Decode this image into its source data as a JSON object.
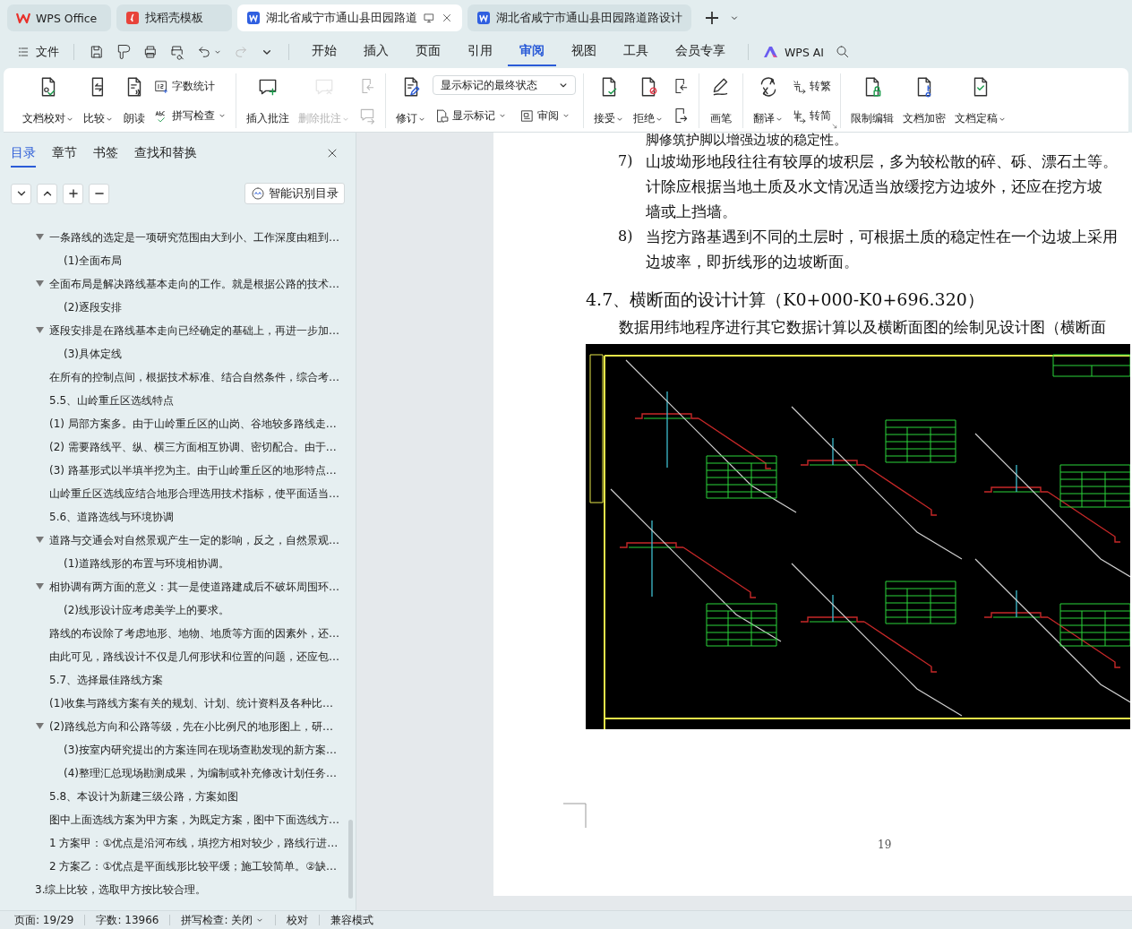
{
  "tabs": [
    {
      "label": "WPS Office",
      "kind": "home",
      "selected": false
    },
    {
      "label": "找稻壳模板",
      "kind": "template",
      "selected": false
    },
    {
      "label": "湖北省咸宁市通山县田园路道",
      "kind": "doc",
      "selected": true
    },
    {
      "label": "湖北省咸宁市通山县田园路道路设计",
      "kind": "doc",
      "selected": false
    }
  ],
  "file_menu": "文件",
  "menu_tabs": [
    {
      "label": "开始",
      "selected": false
    },
    {
      "label": "插入",
      "selected": false
    },
    {
      "label": "页面",
      "selected": false
    },
    {
      "label": "引用",
      "selected": false
    },
    {
      "label": "审阅",
      "selected": true
    },
    {
      "label": "视图",
      "selected": false
    },
    {
      "label": "工具",
      "selected": false
    },
    {
      "label": "会员专享",
      "selected": false
    }
  ],
  "ai_label": "WPS AI",
  "ribbon": {
    "groups": [
      {
        "items": [
          {
            "kind": "large",
            "label": "文档校对",
            "caret": true,
            "disabled": false
          },
          {
            "kind": "large",
            "label": "比较",
            "caret": true,
            "disabled": false
          },
          {
            "kind": "large",
            "label": "朗读",
            "disabled": false
          },
          {
            "kind": "stack",
            "items": [
              {
                "kind": "small",
                "label": "字数统计",
                "disabled": false
              },
              {
                "kind": "small",
                "label": "拼写检查",
                "caret": true,
                "disabled": false
              }
            ]
          }
        ]
      },
      {
        "items": [
          {
            "kind": "large",
            "label": "插入批注",
            "disabled": false
          },
          {
            "kind": "large",
            "label": "删除批注",
            "caret": true,
            "disabled": true
          },
          {
            "kind": "stack",
            "items": [
              {
                "kind": "icon",
                "disabled": true
              },
              {
                "kind": "icon",
                "disabled": true
              }
            ]
          }
        ]
      },
      {
        "items": [
          {
            "kind": "large",
            "label": "修订",
            "caret": true,
            "disabled": false
          },
          {
            "kind": "stack",
            "items": [
              {
                "kind": "select",
                "value": "显示标记的最终状态"
              },
              {
                "kind": "pair",
                "items": [
                  {
                    "kind": "small",
                    "label": "显示标记",
                    "caret": true,
                    "disabled": false
                  },
                  {
                    "kind": "small",
                    "label": "审阅",
                    "caret": true,
                    "disabled": false
                  }
                ]
              }
            ]
          }
        ]
      },
      {
        "items": [
          {
            "kind": "large",
            "label": "接受",
            "caret": true,
            "disabled": false
          },
          {
            "kind": "large",
            "label": "拒绝",
            "caret": true,
            "disabled": false
          },
          {
            "kind": "stack",
            "items": [
              {
                "kind": "icon",
                "disabled": false
              },
              {
                "kind": "icon",
                "disabled": false
              }
            ]
          }
        ]
      },
      {
        "items": [
          {
            "kind": "large",
            "label": "画笔",
            "disabled": false
          }
        ]
      },
      {
        "launcher": true,
        "items": [
          {
            "kind": "large",
            "label": "翻译",
            "caret": true,
            "disabled": false
          },
          {
            "kind": "stack",
            "items": [
              {
                "kind": "small",
                "label": "转繁",
                "disabled": false
              },
              {
                "kind": "small",
                "label": "转简",
                "disabled": false
              }
            ]
          }
        ]
      },
      {
        "items": [
          {
            "kind": "large",
            "label": "限制编辑",
            "disabled": false
          },
          {
            "kind": "large",
            "label": "文档加密",
            "disabled": false
          },
          {
            "kind": "large",
            "label": "文档定稿",
            "caret": true,
            "disabled": false
          }
        ]
      }
    ]
  },
  "nav": {
    "tabs": [
      {
        "label": "目录",
        "selected": true
      },
      {
        "label": "章节",
        "selected": false
      },
      {
        "label": "书签",
        "selected": false
      },
      {
        "label": "查找和替换",
        "selected": false
      }
    ],
    "smart_button": "智能识别目录",
    "items": [
      {
        "label": "一条路线的选定是一项研究范围由大到小、工作深度由粗到…",
        "expanded": true,
        "children": [
          {
            "label": "(1)全面布局"
          }
        ]
      },
      {
        "label": "全面布局是解决路线基本走向的工作。就是根据公路的技术…",
        "expanded": true,
        "children": [
          {
            "label": "(2)逐段安排"
          }
        ]
      },
      {
        "label": "逐段安排是在路线基本走向已经确定的基础上，再进一步加…",
        "expanded": true,
        "children": [
          {
            "label": "(3)具体定线"
          }
        ]
      },
      {
        "label": "在所有的控制点间，根据技术标准、结合自然条件，综合考…"
      },
      {
        "label": "5.5、山岭重丘区选线特点"
      },
      {
        "label": "(1) 局部方案多。由于山岭重丘区的山岗、谷地较多路线走…"
      },
      {
        "label": "(2) 需要路线平、纵、横三方面相互协调、密切配合。由于…"
      },
      {
        "label": "(3) 路基形式以半填半挖为主。由于山岭重丘区的地形特点…"
      },
      {
        "label": "山岭重丘区选线应结合地形合理选用技术指标，使平面适当…"
      },
      {
        "label": "5.6、道路选线与环境协调"
      },
      {
        "label": "道路与交通会对自然景观产生一定的影响，反之，自然景观…",
        "expanded": true,
        "children": [
          {
            "label": "(1)道路线形的布置与环境相协调。"
          }
        ]
      },
      {
        "label": "相协调有两方面的意义：其一是使道路建成后不破坏周围环…",
        "expanded": true,
        "children": [
          {
            "label": "(2)线形设计应考虑美学上的要求。"
          }
        ]
      },
      {
        "label": "路线的布设除了考虑地形、地物、地质等方面的因素外，还…"
      },
      {
        "label": "由此可见，路线设计不仅是几何形状和位置的问题，还应包…"
      },
      {
        "label": "5.7、选择最佳路线方案"
      },
      {
        "label": "(1)收集与路线方案有关的规划、计划、统计资料及各种比…"
      },
      {
        "label": "(2)路线总方向和公路等级，先在小比例尺的地形图上，研…",
        "expanded": true,
        "children": [
          {
            "label": "(3)按室内研究提出的方案连同在现场查勘发现的新方案…"
          },
          {
            "label": "(4)整理汇总现场勘测成果，为编制或补充修改计划任务…"
          }
        ]
      },
      {
        "label": "5.8、本设计为新建三级公路，方案如图"
      },
      {
        "label": "图中上面选线方案为甲方案，为既定方案，图中下面选线方…"
      },
      {
        "label": "1 方案甲：①优点是沿河布线，填挖方相对较少，路线行进…"
      },
      {
        "label": "2 方案乙：①优点是平面线形比较平缓；施工较简单。②缺…"
      }
    ],
    "outer_items": [
      {
        "label": "3.综上比较，选取甲方按比较合理。"
      }
    ]
  },
  "document": {
    "top_line": "脚修筑护脚以增强边坡的稳定性。",
    "list": [
      {
        "marker": "7)",
        "lines": [
          "山坡坳形地段往往有较厚的坡积层，多为较松散的碎、砾、漂石土等。",
          "计除应根据当地土质及水文情况适当放缓挖方边坡外，还应在挖方坡",
          "墙或上挡墙。"
        ]
      },
      {
        "marker": "8)",
        "lines": [
          "当挖方路基遇到不同的土层时，可根据土质的稳定性在一个边坡上采用",
          "边坡率，即折线形的边坡断面。"
        ]
      }
    ],
    "heading": "4.7、横断面的设计计算（K0+000-K0+696.320）",
    "paragraph": "数据用纬地程序进行其它数据计算以及横断面图的绘制见设计图（横断面",
    "page_number": "19"
  },
  "status_bar": {
    "page": "页面: 19/29",
    "words": "字数: 13966",
    "spell": "拼写检查: 关闭",
    "proofread": "校对",
    "mode": "兼容模式"
  }
}
